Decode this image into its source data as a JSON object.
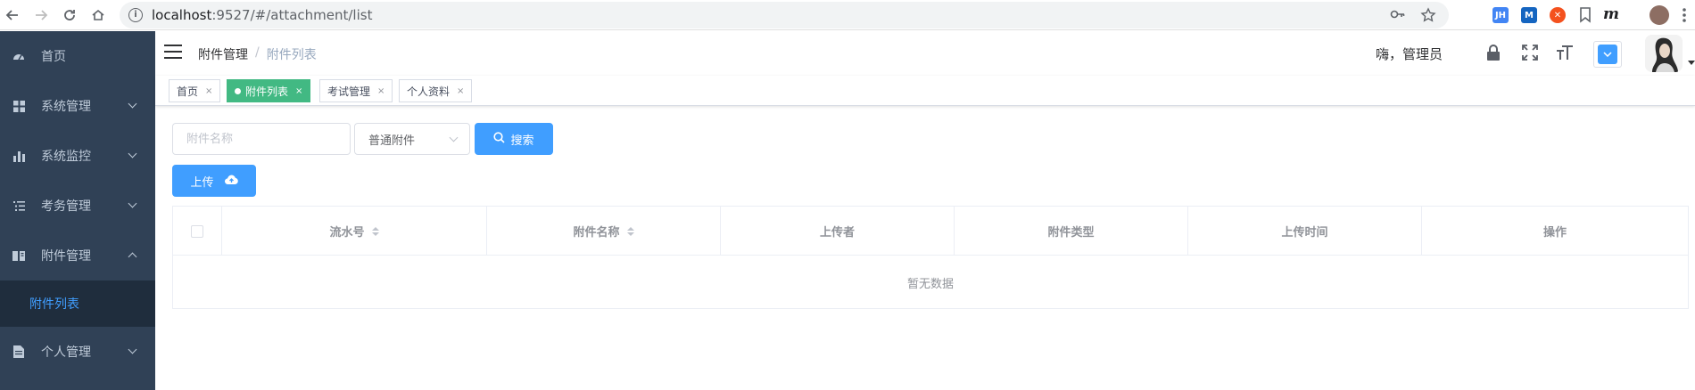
{
  "browser": {
    "url_host": "localhost",
    "url_path": ":9527/#/attachment/list",
    "extensions": [
      {
        "name": "jh-extension",
        "label": "JH",
        "color": "#4285f4"
      },
      {
        "name": "m-extension",
        "label": "M",
        "color": "#1565c0"
      },
      {
        "name": "orange-extension",
        "label": "✕",
        "color": "#f4511e"
      }
    ]
  },
  "sidebar": {
    "items": [
      {
        "label": "首页",
        "icon": "dashboard-icon",
        "has_arrow": false
      },
      {
        "label": "系统管理",
        "icon": "grid-icon",
        "has_arrow": true
      },
      {
        "label": "系统监控",
        "icon": "bar-chart-icon",
        "has_arrow": true
      },
      {
        "label": "考务管理",
        "icon": "list-icon",
        "has_arrow": true
      },
      {
        "label": "附件管理",
        "icon": "book-icon",
        "has_arrow": true,
        "expanded": true
      },
      {
        "label": "附件列表",
        "submenu": true,
        "active": true
      },
      {
        "label": "个人管理",
        "icon": "doc-icon",
        "has_arrow": true
      }
    ],
    "bg_color": "#304156",
    "active_color": "#409eff"
  },
  "navbar": {
    "breadcrumb": [
      "附件管理",
      "附件列表"
    ],
    "separator": "/",
    "greeting": "嗨，管理员"
  },
  "tags": [
    {
      "label": "首页",
      "active": false
    },
    {
      "label": "附件列表",
      "active": true
    },
    {
      "label": "考试管理",
      "active": false
    },
    {
      "label": "个人资料",
      "active": false
    }
  ],
  "tag_close": "×",
  "filter": {
    "name_placeholder": "附件名称",
    "type_value": "普通附件",
    "search_label": "搜索",
    "upload_label": "上传"
  },
  "table": {
    "columns": [
      "流水号",
      "附件名称",
      "上传者",
      "附件类型",
      "上传时间",
      "操作"
    ],
    "sortable": [
      true,
      true,
      false,
      false,
      false,
      false
    ],
    "empty_text": "暂无数据"
  },
  "colors": {
    "primary": "#409eff",
    "tag_active": "#42b983"
  }
}
